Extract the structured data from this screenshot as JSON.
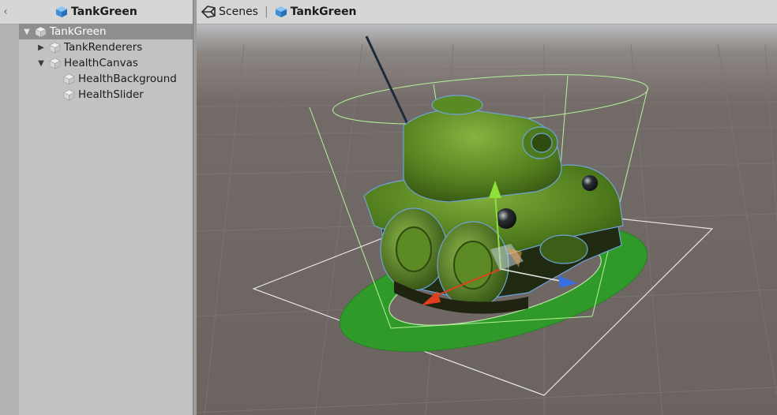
{
  "hierarchy": {
    "title": "TankGreen",
    "back_icon": "chevron-left-icon",
    "items": [
      {
        "label": "TankGreen",
        "depth": 0,
        "foldout": "expanded",
        "selected": true
      },
      {
        "label": "TankRenderers",
        "depth": 1,
        "foldout": "collapsed",
        "selected": false
      },
      {
        "label": "HealthCanvas",
        "depth": 1,
        "foldout": "expanded",
        "selected": false
      },
      {
        "label": "HealthBackground",
        "depth": 2,
        "foldout": "none",
        "selected": false
      },
      {
        "label": "HealthSlider",
        "depth": 2,
        "foldout": "none",
        "selected": false
      }
    ]
  },
  "scene": {
    "breadcrumb": {
      "scenes_label": "Scenes",
      "separator": "|",
      "prefab_label": "TankGreen"
    },
    "colors": {
      "tank_body": "#4f7a1c",
      "health_ring": "#33a02c",
      "grid_floor": "#6f6763",
      "sky": "#bfc4c9",
      "gizmo_x": "#e0401f",
      "gizmo_y": "#8ee03a",
      "gizmo_z": "#3a6fe0"
    }
  }
}
